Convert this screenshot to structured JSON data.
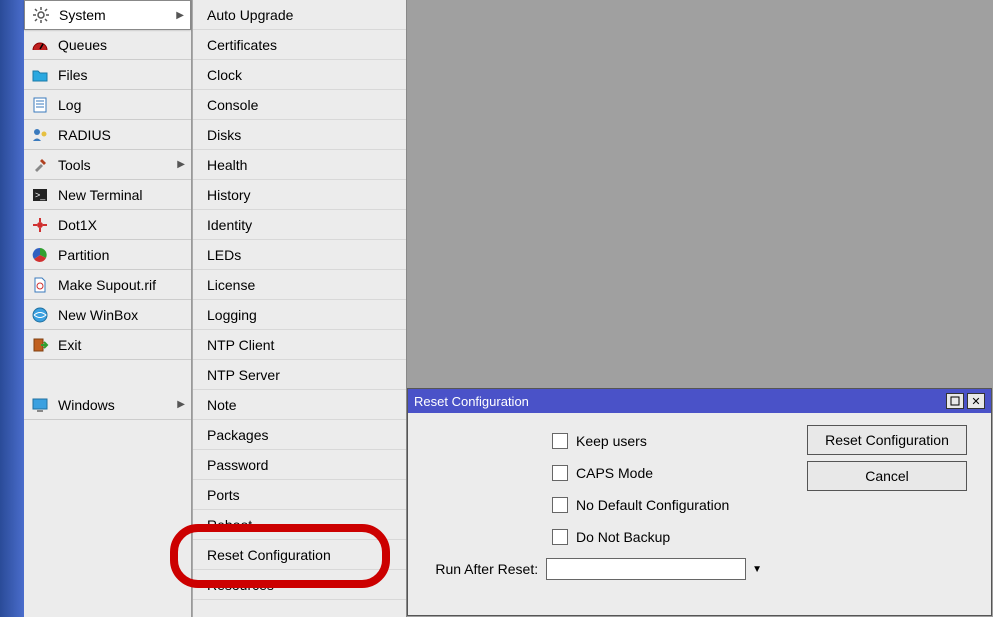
{
  "sidebar": {
    "items": [
      {
        "label": "System",
        "icon": "gear",
        "has_sub": true,
        "selected": true
      },
      {
        "label": "Queues",
        "icon": "gauge"
      },
      {
        "label": "Files",
        "icon": "folder"
      },
      {
        "label": "Log",
        "icon": "list"
      },
      {
        "label": "RADIUS",
        "icon": "user"
      },
      {
        "label": "Tools",
        "icon": "wrench",
        "has_sub": true
      },
      {
        "label": "New Terminal",
        "icon": "terminal"
      },
      {
        "label": "Dot1X",
        "icon": "dot"
      },
      {
        "label": "Partition",
        "icon": "pie"
      },
      {
        "label": "Make Supout.rif",
        "icon": "file"
      },
      {
        "label": "New WinBox",
        "icon": "globe"
      },
      {
        "label": "Exit",
        "icon": "exit"
      }
    ],
    "windows": {
      "label": "Windows",
      "icon": "monitor",
      "has_sub": true
    }
  },
  "submenu": {
    "items": [
      "Auto Upgrade",
      "Certificates",
      "Clock",
      "Console",
      "Disks",
      "Health",
      "History",
      "Identity",
      "LEDs",
      "License",
      "Logging",
      "NTP Client",
      "NTP Server",
      "Note",
      "Packages",
      "Password",
      "Ports",
      "Reboot",
      "Reset Configuration",
      "Resources"
    ]
  },
  "dialog": {
    "title": "Reset Configuration",
    "checkboxes": [
      "Keep users",
      "CAPS Mode",
      "No Default Configuration",
      "Do Not Backup"
    ],
    "run_after_label": "Run After Reset:",
    "buttons": {
      "reset": "Reset Configuration",
      "cancel": "Cancel"
    }
  }
}
